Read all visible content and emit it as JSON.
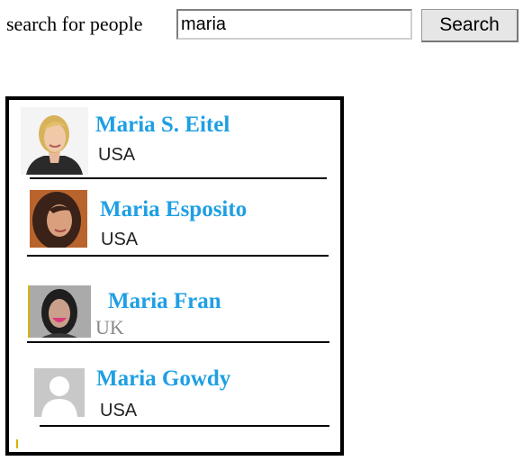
{
  "search": {
    "label": "search for people",
    "value": "maria",
    "button_label": "Search"
  },
  "results": [
    {
      "name": "Maria S. Eitel",
      "country": "USA",
      "avatar_icon": "photo-blonde-woman"
    },
    {
      "name": "Maria Esposito",
      "country": "USA",
      "avatar_icon": "photo-dark-hair-woman"
    },
    {
      "name": "Maria Fran",
      "country": "UK",
      "avatar_icon": "photo-smiling-woman"
    },
    {
      "name": "Maria Gowdy",
      "country": "USA",
      "avatar_icon": "default-avatar-placeholder"
    }
  ],
  "colors": {
    "name_link": "#1e9fe3",
    "border": "#000000",
    "button_bg": "#e6e6e6"
  }
}
